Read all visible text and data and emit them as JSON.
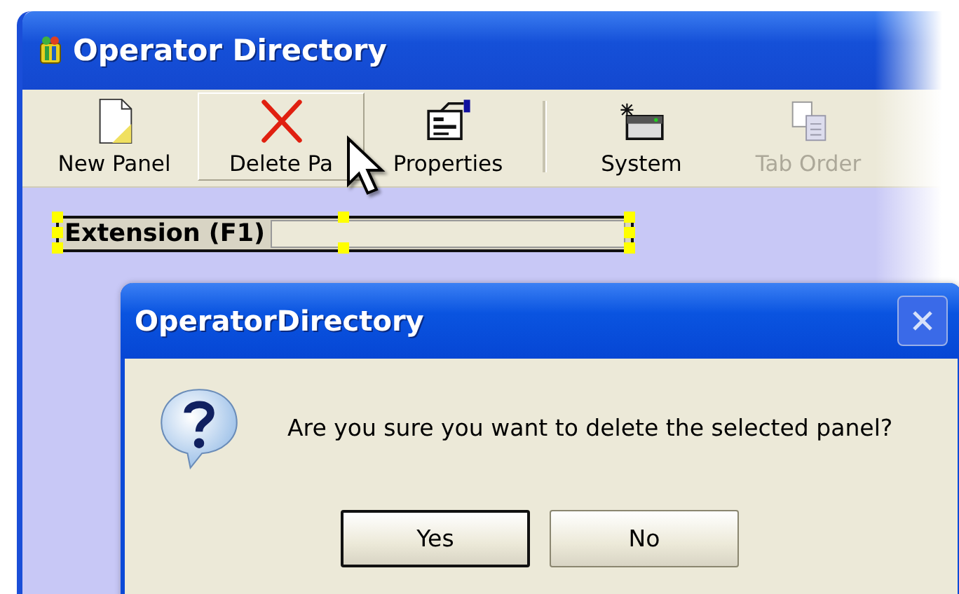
{
  "window": {
    "title": "Operator Directory"
  },
  "toolbar": [
    {
      "label": "New Panel",
      "kind": "new",
      "highlighted": false,
      "disabled": false
    },
    {
      "label": "Delete Pa",
      "kind": "delete",
      "highlighted": true,
      "disabled": false
    },
    {
      "label": "Properties",
      "kind": "properties",
      "highlighted": false,
      "disabled": false
    },
    {
      "label": "System",
      "kind": "system",
      "highlighted": false,
      "disabled": false
    },
    {
      "label": "Tab Order",
      "kind": "taborder",
      "highlighted": false,
      "disabled": true
    }
  ],
  "panel_control": {
    "label": "Extension (F1)",
    "selected": true
  },
  "dialog": {
    "title": "OperatorDirectory",
    "message": "Are you sure you want to delete the selected panel?",
    "close_disabled": true,
    "buttons": [
      {
        "label": "Yes",
        "default": true
      },
      {
        "label": "No",
        "default": false
      }
    ]
  }
}
